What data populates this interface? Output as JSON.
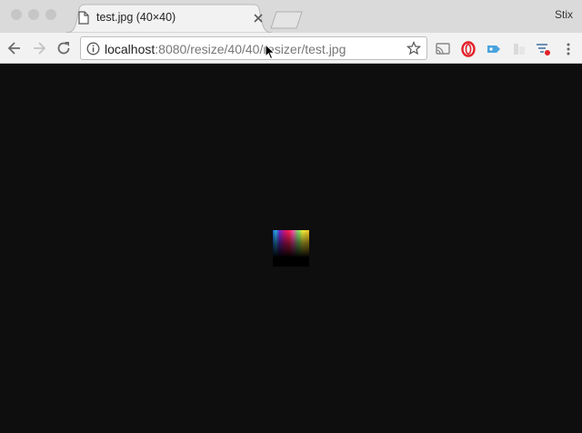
{
  "window": {
    "profile_name": "Stix"
  },
  "tab": {
    "title": "test.jpg (40×40)",
    "favicon": "file-icon",
    "close_icon": "close-icon"
  },
  "toolbar": {
    "back_icon": "back-arrow-icon",
    "forward_icon": "forward-arrow-icon",
    "reload_icon": "reload-icon",
    "url_host": "localhost",
    "url_path": ":8080/resize/40/40/resizer/test.jpg",
    "bookmark_icon": "star-icon",
    "extensions": [
      "cast-icon",
      "opera-icon",
      "tag-extension-icon",
      "grey-extension-icon",
      "filter-extension-icon"
    ]
  },
  "viewport": {
    "background": "#0e0e0e",
    "image": {
      "description_colors": [
        "#1e5bd6",
        "#d3147e",
        "#ff4fb0",
        "#7be36a",
        "#f2f03a"
      ]
    }
  },
  "colors": {
    "tabstrip": "#dadada",
    "toolbar": "#f2f2f2",
    "opera_red": "#e3202a",
    "tag_blue": "#4aa3df"
  }
}
